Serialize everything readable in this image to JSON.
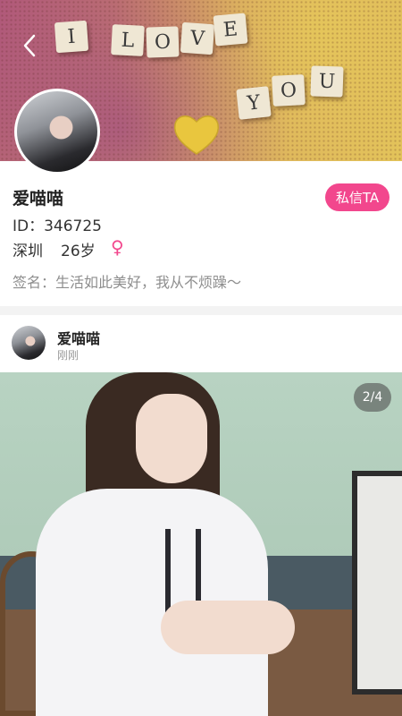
{
  "header": {
    "banner_tiles_line1": [
      "I",
      "L",
      "O",
      "V",
      "E"
    ],
    "banner_tiles_line2": [
      "Y",
      "O",
      "U"
    ]
  },
  "profile": {
    "name": "爱喵喵",
    "message_button": "私信TA",
    "id_text": "ID：346725",
    "city": "深圳",
    "age": "26岁",
    "gender_symbol": "♀",
    "signature_label": "签名：",
    "signature_text": "生活如此美好，我从不烦躁～"
  },
  "post": {
    "author": "爱喵喵",
    "time": "刚刚",
    "image_counter": "2/4"
  },
  "colors": {
    "accent": "#f2478d",
    "secondary_text": "#8e8e8e",
    "divider": "#f3f3f3"
  },
  "icons": {
    "back": "back-arrow-icon",
    "gender": "female-icon"
  }
}
